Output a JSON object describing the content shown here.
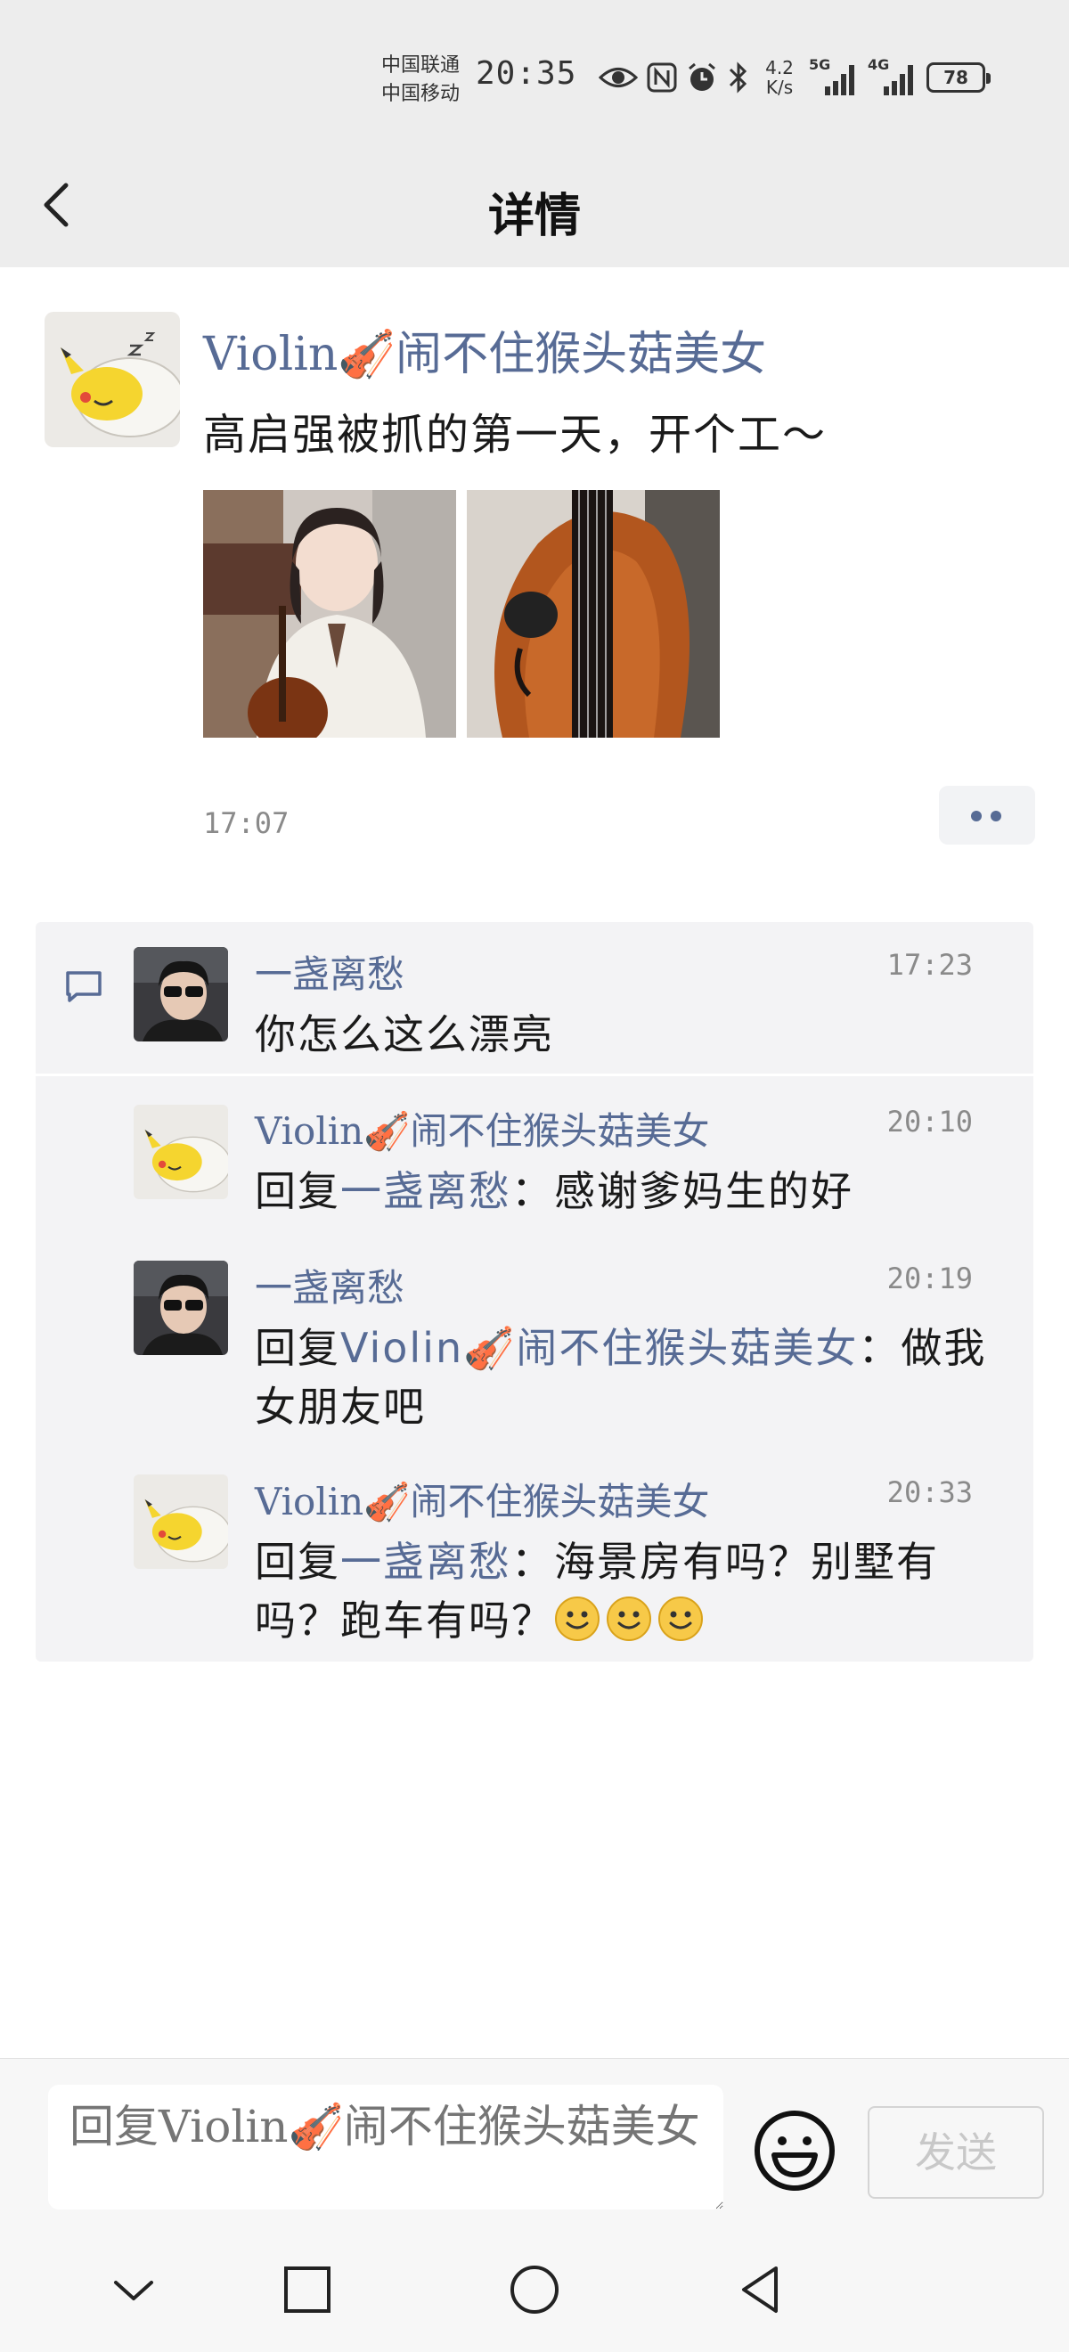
{
  "status_bar": {
    "carrier_1": "中国联通",
    "carrier_2": "中国移动",
    "time": "20:35",
    "net_speed_value": "4.2",
    "net_speed_unit": "K/s",
    "signal_1_type": "5G",
    "signal_2_type": "4G",
    "battery": "78"
  },
  "header": {
    "title": "详情"
  },
  "post": {
    "author": "Violin🎻闹不住猴头菇美女",
    "text": "高启强被抓的第一天，开个工～",
    "time": "17:07"
  },
  "comments": [
    {
      "author": "一盏离愁",
      "time": "17:23",
      "text": "你怎么这么漂亮"
    },
    {
      "author": "Violin🎻闹不住猴头菇美女",
      "time": "20:10",
      "reply_prefix": "回复",
      "reply_to": "一盏离愁",
      "text": "：感谢爹妈生的好"
    },
    {
      "author": "一盏离愁",
      "time": "20:19",
      "reply_prefix": "回复",
      "reply_to": "Violin🎻闹不住猴头菇美女",
      "text": "：做我女朋友吧"
    },
    {
      "author": "Violin🎻闹不住猴头菇美女",
      "time": "20:33",
      "reply_prefix": "回复",
      "reply_to": "一盏离愁",
      "text": "：海景房有吗？别墅有吗？跑车有吗？"
    }
  ],
  "input": {
    "placeholder": "回复Violin🎻闹不住猴头菇美女",
    "send_label": "发送"
  },
  "icons": {
    "back": "chevron-left-icon",
    "comment": "comment-bubble-icon",
    "emoji": "smiley-face-icon"
  },
  "colors": {
    "link": "#576b95",
    "bar_bg": "#ededed",
    "comment_bg": "#f3f3f5"
  }
}
